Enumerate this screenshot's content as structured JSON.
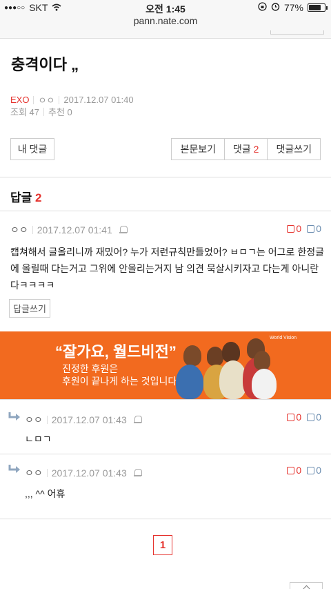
{
  "status_bar": {
    "signal": "●●●○○",
    "carrier": "SKT",
    "time": "오전 1:45",
    "battery": "77%",
    "battery_level": 0.77
  },
  "url": "pann.nate.com",
  "post": {
    "title": "충격이다 „",
    "category": "EXO",
    "author": "ㅇㅇ",
    "date": "2017.12.07 01:40",
    "views": "조회 47",
    "recommend": "추천 0"
  },
  "buttons": {
    "my_comments": "내 댓글",
    "view_post": "본문보기",
    "comments_label": "댓글",
    "comments_count": "2",
    "write_comment": "댓글쓰기"
  },
  "replies_header": {
    "label": "답글",
    "count": "2"
  },
  "comment": {
    "author": "ㅇㅇ",
    "date": "2017.12.07 01:41",
    "up": "0",
    "down": "0",
    "text": "캡쳐해서 글올리니까 재밌어? 누가 저런규칙만들었어? ㅂㅁㄱ는 어그로 한정글에 올릴때 다는거고 그위에 안올리는거지 남 의견 묵살시키자고 다는게 아니란다ㅋㅋㅋㅋ",
    "reply_button": "답글쓰기"
  },
  "ad": {
    "title": "“잘가요, 월드비전”",
    "line1": "진정한 후원은",
    "line2": "후원이 끝나게 하는 것입니다.",
    "logo": "World Vision"
  },
  "replies": [
    {
      "author": "ㅇㅇ",
      "date": "2017.12.07 01:43",
      "up": "0",
      "down": "0",
      "text": "ㄴㅁㄱ"
    },
    {
      "author": "ㅇㅇ",
      "date": "2017.12.07 01:43",
      "up": "0",
      "down": "0",
      "text": ",,, ^^ 어휴"
    }
  ],
  "pagination": {
    "current": "1"
  },
  "colors": {
    "accent": "#e5322d",
    "ad_orange": "#f26a1f",
    "down_blue": "#6a8caf"
  }
}
